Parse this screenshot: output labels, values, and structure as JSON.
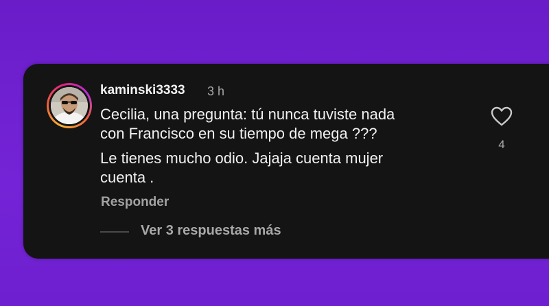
{
  "comment": {
    "username": "kaminski3333",
    "timestamp": "3 h",
    "lines": [
      "Cecilia, una pregunta: tú nunca tuviste nada",
      "con Francisco en su tiempo de mega ???",
      "Le tienes mucho odio. Jajaja cuenta mujer",
      "cuenta ."
    ],
    "reply_label": "Responder",
    "view_replies_label": "Ver 3 respuestas más",
    "like_count": "4",
    "icons": {
      "like": "heart-icon",
      "avatar": "user-avatar"
    }
  },
  "colors": {
    "background": "#6f1fd0",
    "card": "#141414",
    "text_primary": "#f2f2f2",
    "text_secondary": "#a6a6a6"
  }
}
